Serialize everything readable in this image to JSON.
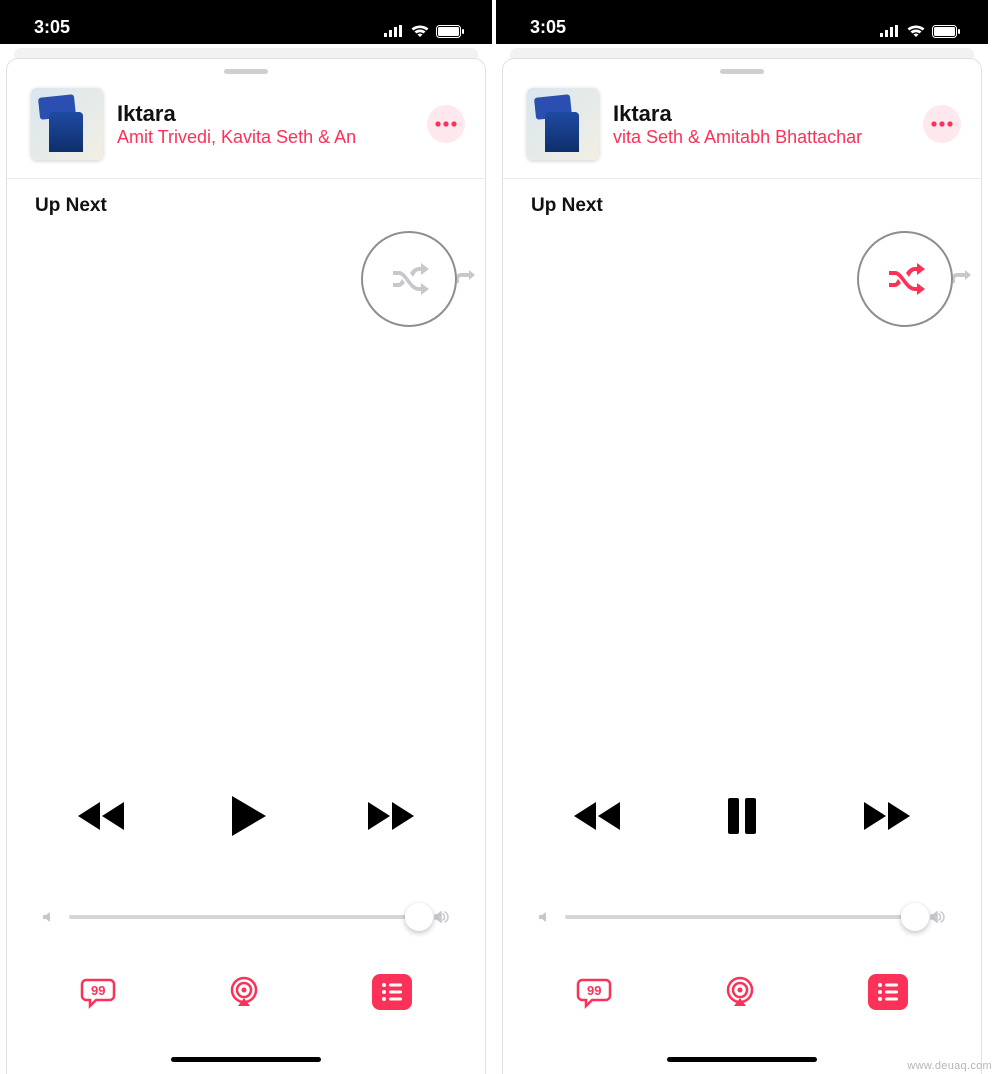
{
  "colors": {
    "accent": "#fc3158",
    "muted_icon": "#c7c7cc"
  },
  "watermark": "www.deuaq.com",
  "screens": [
    {
      "status": {
        "time": "3:05"
      },
      "now_playing": {
        "title": "Iktara",
        "artist": "Amit Trivedi, Kavita Seth & An"
      },
      "up_next_label": "Up Next",
      "shuffle_active": false,
      "playback_state": "play"
    },
    {
      "status": {
        "time": "3:05"
      },
      "now_playing": {
        "title": "Iktara",
        "artist": "vita Seth & Amitabh Bhattachar"
      },
      "up_next_label": "Up Next",
      "shuffle_active": true,
      "playback_state": "pause"
    }
  ]
}
